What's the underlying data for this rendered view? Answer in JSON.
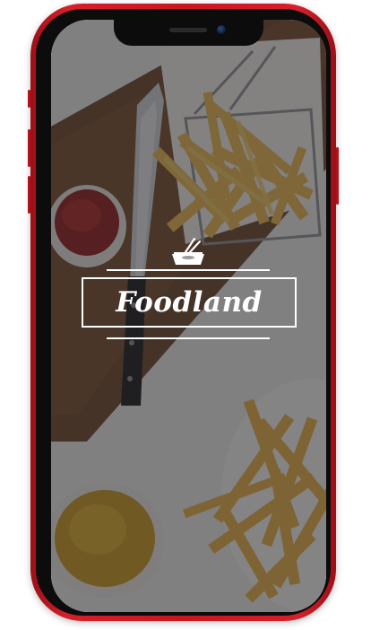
{
  "app": {
    "name": "Foodland",
    "logo_icon": "chopsticks-bowl-icon"
  },
  "colors": {
    "phone_frame": "#c8161f",
    "overlay": "#28282c",
    "logo": "#ffffff"
  }
}
